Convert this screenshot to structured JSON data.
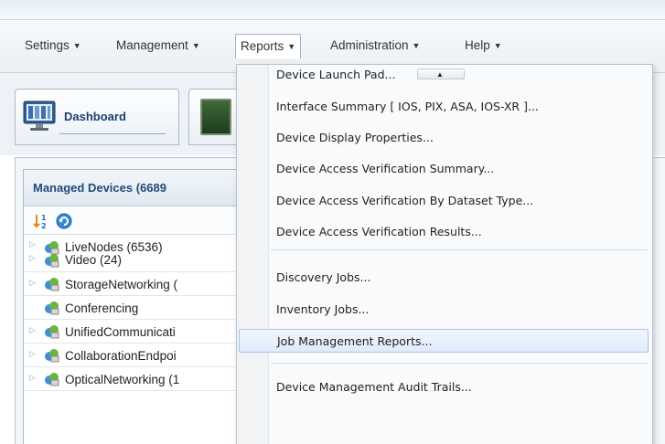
{
  "menubar": {
    "items": [
      {
        "label": "Settings"
      },
      {
        "label": "Management"
      },
      {
        "label": "Reports"
      },
      {
        "label": "Administration"
      },
      {
        "label": "Help"
      }
    ],
    "caret": "▼"
  },
  "tabs": [
    {
      "label": "Dashboard",
      "icon": "dashboard-icon"
    },
    {
      "label": "",
      "icon": "device-board-icon"
    }
  ],
  "panel": {
    "title": "Managed Devices (6689",
    "toolbar": [
      {
        "icon": "sort-icon"
      },
      {
        "icon": "refresh-icon"
      }
    ],
    "tree": [
      {
        "label": "LiveNodes (6536)",
        "expandable": true
      },
      {
        "label": "Video (24)",
        "expandable": true
      },
      {
        "label": "StorageNetworking (",
        "expandable": true
      },
      {
        "label": "Conferencing",
        "expandable": false
      },
      {
        "label": "UnifiedCommunicati",
        "expandable": true
      },
      {
        "label": "CollaborationEndpoi",
        "expandable": true
      },
      {
        "label": "OpticalNetworking (1",
        "expandable": true
      }
    ]
  },
  "reports_menu": {
    "items": [
      {
        "label": "Device Launch Pad..."
      },
      {
        "label": "Interface Summary [ IOS, PIX, ASA, IOS-XR ]..."
      },
      {
        "label": "Device Display Properties..."
      },
      {
        "label": "Device Access Verification Summary..."
      },
      {
        "label": "Device Access Verification By Dataset Type..."
      },
      {
        "label": "Device Access Verification Results..."
      },
      {
        "label": "Discovery Jobs..."
      },
      {
        "label": "Inventory Jobs..."
      },
      {
        "label": "Job Management Reports..."
      },
      {
        "label": "Device Management Audit Trails..."
      }
    ],
    "highlighted": "Job Management Reports...",
    "accent_color": "#a9c3e6"
  }
}
